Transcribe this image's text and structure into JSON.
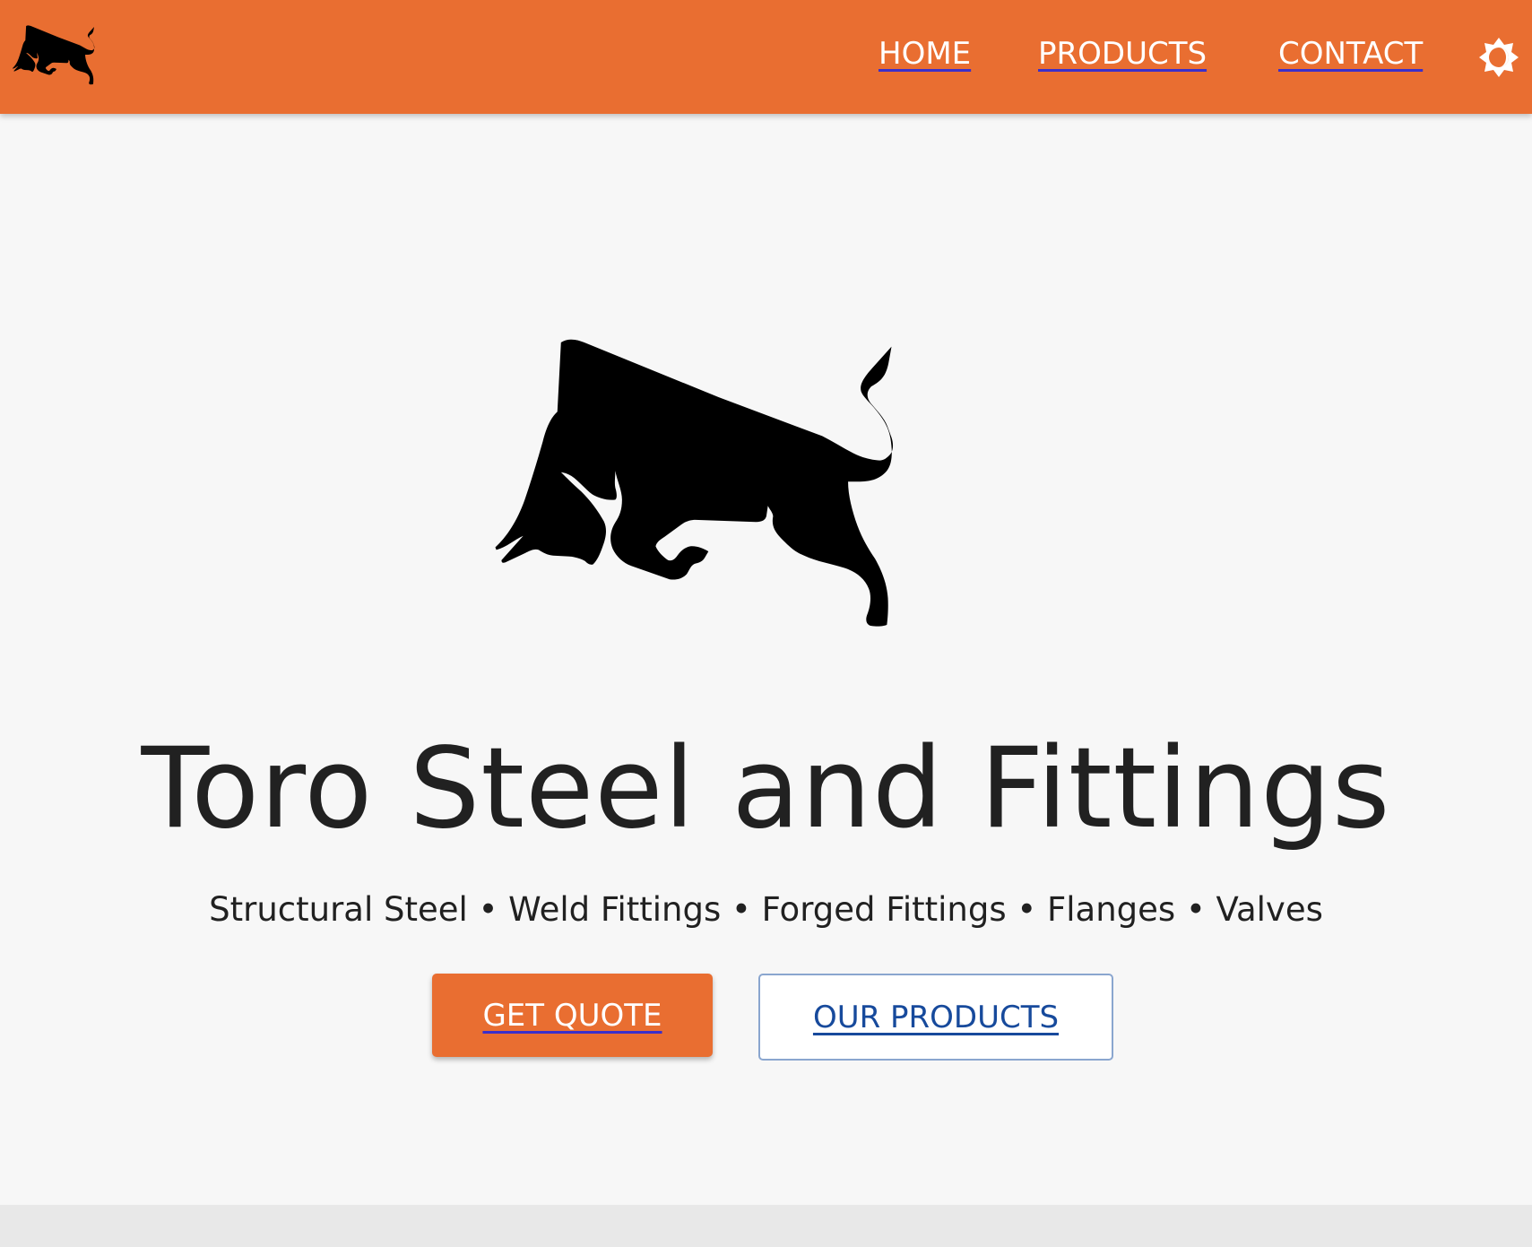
{
  "navbar": {
    "logo_icon": "bull-logo-icon",
    "links": [
      {
        "label": "HOME"
      },
      {
        "label": "PRODUCTS"
      },
      {
        "label": "CONTACT"
      }
    ],
    "theme_toggle_icon": "brightness-icon"
  },
  "hero": {
    "logo_icon": "bull-icon",
    "title": "Toro Steel and Fittings",
    "subtitle": "Structural Steel • Weld Fittings • Forged Fittings • Flanges • Valves",
    "primary_button": "GET QUOTE",
    "secondary_button": "OUR PRODUCTS"
  },
  "colors": {
    "brand": "#e96e31",
    "text": "#212121",
    "background": "#f7f7f7",
    "link_blue": "#174a9c"
  }
}
